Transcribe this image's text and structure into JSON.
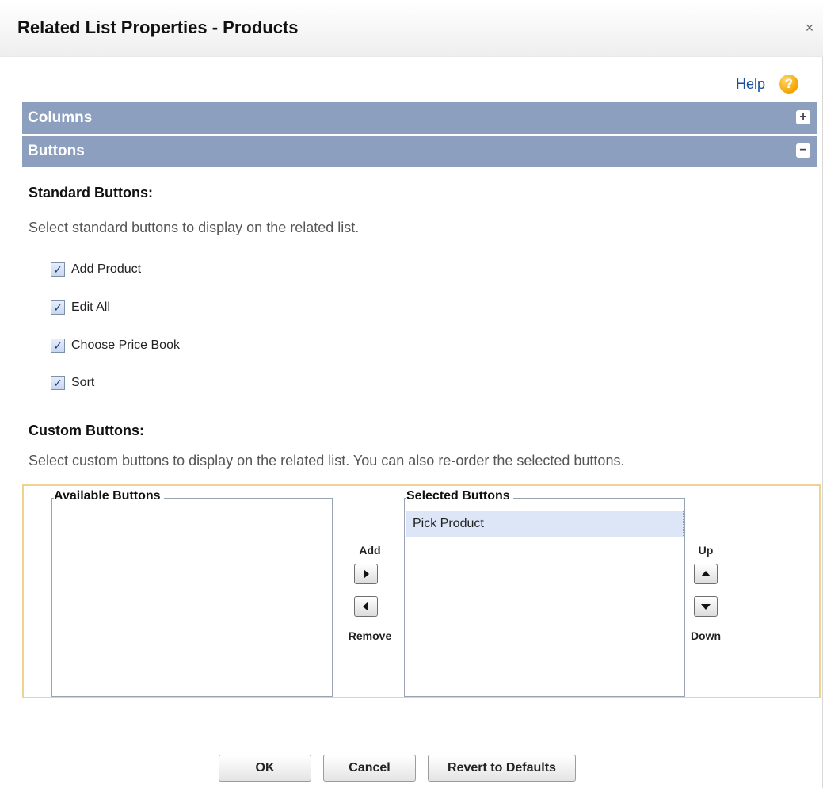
{
  "dialog": {
    "title": "Related List Properties - Products",
    "close_glyph": "×"
  },
  "help": {
    "link_label": "Help",
    "icon_glyph": "?"
  },
  "sections": {
    "columns": {
      "label": "Columns",
      "toggle_glyph": "+"
    },
    "buttons": {
      "label": "Buttons",
      "toggle_glyph": "−"
    }
  },
  "standard_buttons": {
    "heading": "Standard Buttons:",
    "description": "Select standard buttons to display on the related list.",
    "items": [
      {
        "label": "Add Product",
        "checked": true
      },
      {
        "label": "Edit All",
        "checked": true
      },
      {
        "label": "Choose Price Book",
        "checked": true
      },
      {
        "label": "Sort",
        "checked": true
      }
    ],
    "check_glyph": "✓"
  },
  "custom_buttons": {
    "heading": "Custom Buttons:",
    "description": "Select custom buttons to display on the related list. You can also re-order the selected buttons.",
    "available_label": "Available Buttons",
    "selected_label": "Selected Buttons",
    "selected_items": [
      "Pick Product"
    ],
    "add_label": "Add",
    "remove_label": "Remove",
    "up_label": "Up",
    "down_label": "Down"
  },
  "footer": {
    "ok_label": "OK",
    "cancel_label": "Cancel",
    "revert_label": "Revert to Defaults"
  },
  "colors": {
    "section_header_bg": "#8c9fbf",
    "panel_border": "#efd28f",
    "selected_item_bg": "#dde6f7",
    "link": "#1a4f9c"
  }
}
